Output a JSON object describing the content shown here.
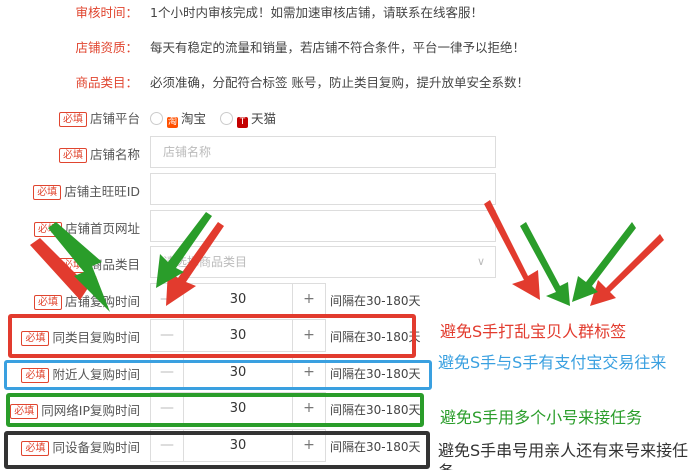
{
  "info": [
    {
      "label": "审核时间：",
      "text": "1个小时内审核完成！如需加速审核店铺，请联系在线客服！"
    },
    {
      "label": "店铺资质：",
      "text": "每天有稳定的流量和销量，若店铺不符合条件，平台一律予以拒绝！"
    },
    {
      "label": "商品类目：",
      "text": "必须准确，分配符合标签 账号，防止类目复购，提升放单安全系数！"
    }
  ],
  "required_tag": "必填",
  "platform": {
    "label": "店铺平台",
    "options": [
      {
        "name": "淘宝",
        "icon": "taobao-icon"
      },
      {
        "name": "天猫",
        "icon": "tmall-icon"
      }
    ]
  },
  "fields": [
    {
      "label": "店铺名称",
      "placeholder": "店铺名称"
    },
    {
      "label": "店铺主旺旺ID",
      "placeholder": ""
    },
    {
      "label": "店铺首页网址",
      "placeholder": ""
    }
  ],
  "category": {
    "label": "商品类目",
    "placeholder": "请选择商品类目"
  },
  "repurchase": [
    {
      "label": "店铺复购时间",
      "value": "30",
      "interval": "间隔在30-180天",
      "minus": "—",
      "plus": "+"
    },
    {
      "label": "同类目复购时间",
      "value": "30",
      "interval": "间隔在30-180天",
      "minus": "—",
      "plus": "+"
    },
    {
      "label": "附近人复购时间",
      "value": "30",
      "interval": "间隔在30-180天",
      "minus": "—",
      "plus": "+"
    },
    {
      "label": "同网络IP复购时间",
      "value": "30",
      "interval": "间隔在30-180天",
      "minus": "—",
      "plus": "+"
    },
    {
      "label": "同设备复购时间",
      "value": "30",
      "interval": "间隔在30-180天",
      "minus": "—",
      "plus": "+"
    }
  ],
  "annotations": [
    {
      "text": "避免S手打乱宝贝人群标签",
      "color": "#e23b2e"
    },
    {
      "text": "避免S手与S手有支付宝交易往来",
      "color": "#3aa0e0"
    },
    {
      "text": "避免S手用多个小号来接任务",
      "color": "#2a9d2a"
    },
    {
      "text": "避免S手串号用亲人还有来号来接任务",
      "color": "#333333"
    }
  ],
  "colors": {
    "red": "#e23b2e",
    "blue": "#3aa0e0",
    "green": "#2a9d2a",
    "dark": "#333333"
  }
}
